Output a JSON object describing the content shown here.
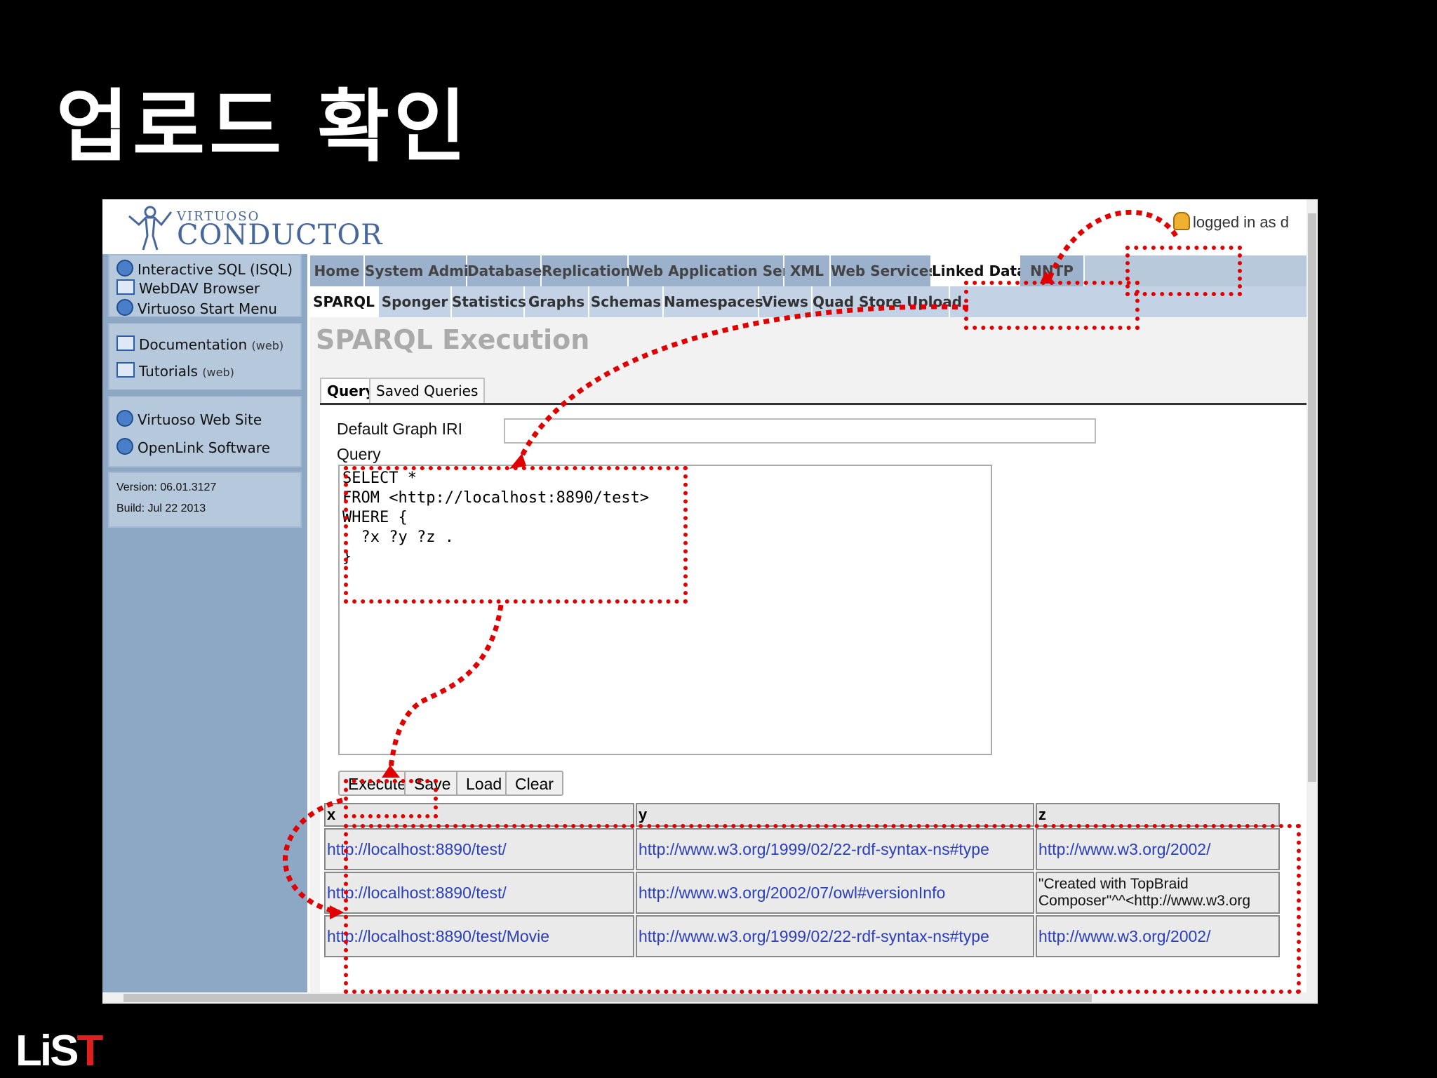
{
  "slide": {
    "title": "업로드 확인",
    "logo_main": "LiS",
    "logo_accent": "T"
  },
  "app": {
    "brand_top": "VIRTUOSO",
    "brand_main": "CONDUCTOR",
    "login_text": "logged in as d"
  },
  "sidebar": {
    "items": [
      {
        "label": "Interactive SQL (ISQL)",
        "icon": "gear-icon"
      },
      {
        "label": "WebDAV Browser",
        "icon": "folder-icon"
      },
      {
        "label": "Virtuoso Start Menu",
        "icon": "globe-icon"
      },
      {
        "label": "Documentation",
        "suffix": "(web)",
        "icon": "document-icon"
      },
      {
        "label": "Tutorials",
        "suffix": "(web)",
        "icon": "tutorial-icon"
      },
      {
        "label": "Virtuoso Web Site",
        "icon": "globe-icon"
      },
      {
        "label": "OpenLink Software",
        "icon": "globe-icon"
      }
    ],
    "version": "Version: 06.01.3127",
    "build": "Build: Jul 22 2013"
  },
  "nav": {
    "main_tabs": [
      "Home",
      "System Admin",
      "Database",
      "Replication",
      "Web Application Server",
      "XML",
      "Web Services",
      "Linked Data",
      "NNTP"
    ],
    "active_main": "Linked Data",
    "sub_tabs": [
      "SPARQL",
      "Sponger",
      "Statistics",
      "Graphs",
      "Schemas",
      "Namespaces",
      "Views",
      "Quad Store Upload"
    ],
    "active_sub": "SPARQL"
  },
  "page": {
    "title": "SPARQL Execution",
    "tabs": [
      "Query",
      "Saved Queries"
    ],
    "default_graph_label": "Default Graph IRI",
    "default_graph_value": "",
    "query_label": "Query",
    "query_text": "SELECT *\nFROM <http://localhost:8890/test>\nWHERE {\n  ?x ?y ?z .\n}",
    "buttons": {
      "execute": "Execute",
      "save": "Save",
      "load": "Load",
      "clear": "Clear"
    }
  },
  "results": {
    "columns": [
      "x",
      "y",
      "z"
    ],
    "rows": [
      [
        "http://localhost:8890/test/",
        "http://www.w3.org/1999/02/22-rdf-syntax-ns#type",
        "http://www.w3.org/2002/"
      ],
      [
        "http://localhost:8890/test/",
        "http://www.w3.org/2002/07/owl#versionInfo",
        "\"Created with TopBraid Composer\"^^<http://www.w3.org"
      ],
      [
        "http://localhost:8890/test/Movie",
        "http://www.w3.org/1999/02/22-rdf-syntax-ns#type",
        "http://www.w3.org/2002/"
      ]
    ]
  },
  "colors": {
    "highlight": "#e00000",
    "sidebar": "#8da8c5",
    "tab": "#9cb2cc",
    "link": "#2a3fb8"
  }
}
